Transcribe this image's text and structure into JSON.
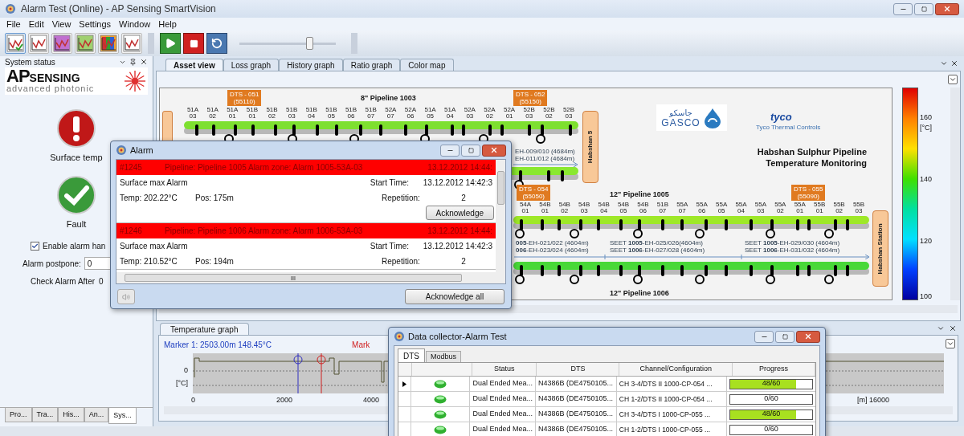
{
  "window": {
    "title": "Alarm Test (Online) - AP Sensing SmartVision"
  },
  "menu": [
    "File",
    "Edit",
    "View",
    "Settings",
    "Window",
    "Help"
  ],
  "toolbar": {
    "slider": {
      "level": 0.74
    }
  },
  "left_panel": {
    "title": "System status",
    "logo": {
      "big": "AP",
      "name": "SENSING",
      "tagline": "advanced photonic"
    },
    "status_items": [
      {
        "kind": "alarm",
        "label": "Surface temp"
      },
      {
        "kind": "ok",
        "label": "Fault"
      }
    ],
    "enable_alarm": {
      "label": "Enable alarm han",
      "checked": true
    },
    "postpone": {
      "label": "Alarm postpone:",
      "value": "0"
    },
    "check_after": {
      "label": "Check Alarm After",
      "value": "0"
    },
    "tabs": [
      {
        "label": "Pro...",
        "selected": false
      },
      {
        "label": "Tra...",
        "selected": false
      },
      {
        "label": "His...",
        "selected": false
      },
      {
        "label": "An...",
        "selected": false
      },
      {
        "label": "Sys...",
        "selected": true
      }
    ]
  },
  "main_tabs": [
    {
      "label": "Asset view",
      "selected": true
    },
    {
      "label": "Loss graph",
      "selected": false
    },
    {
      "label": "History graph",
      "selected": false
    },
    {
      "label": "Ratio graph",
      "selected": false
    },
    {
      "label": "Color map",
      "selected": false
    }
  ],
  "asset_view": {
    "title_lines": [
      "Habshan Sulphur Pipeline",
      "Temperature Monitoring"
    ],
    "gasco": {
      "arabic": "جاسكو",
      "latin": "GASCO"
    },
    "tyco": {
      "name": "tyco",
      "sub": "Tyco Thermal Controls"
    },
    "pipeline_titles": [
      "8\" Pipeline 1003",
      "12\" Pipeline 1005",
      "12\" Pipeline 1006"
    ],
    "dts_boxes": [
      {
        "label": "DTS - 051",
        "sub": "(55110)"
      },
      {
        "label": "DTS - 052",
        "sub": "(55150)"
      },
      {
        "label": "DTS - 054",
        "sub": "(55050)"
      },
      {
        "label": "DTS - 055",
        "sub": "(55090)"
      }
    ],
    "stations": [
      "Habshan 5",
      "Habshan Station"
    ],
    "upper_zones": [
      "51A 03",
      "51A 02",
      "51A 01",
      "51B 01",
      "51B 02",
      "51B 03",
      "51B 04",
      "51B 05",
      "51B 06",
      "51B 07",
      "52A 07",
      "52A 06",
      "51A 05",
      "51A 04",
      "52A 03",
      "52A 02",
      "52A 01",
      "52B 03",
      "52B 02",
      "52B 03"
    ],
    "lower_zones": [
      "54A 01",
      "54B 01",
      "54B 02",
      "54B 03",
      "54B 04",
      "54B 05",
      "54B 06",
      "51B 07",
      "55A 07",
      "55A 06",
      "55A 05",
      "55A 04",
      "55A 03",
      "55A 02",
      "55A 01",
      "55B 01",
      "55B 02",
      "55B 03"
    ],
    "upper_cables": [
      "EH-009/010 (4684m)",
      "EH-011/012 (4684m)"
    ],
    "seet_sections": [
      {
        "top": "**005**-EH-021/022 (4604m)",
        "bottom": "**006**-EH-023/024 (4604m)"
      },
      {
        "top": "SEET **1005**-EH-025/026(4604m)",
        "bottom": "SEET **1006**-EH-027/028 (4604m)"
      },
      {
        "top": "SEET **1005**-EH-029/030 (4604m)",
        "bottom": "SEET **1006**-EH-031/032 (4604m)"
      }
    ]
  },
  "color_scale": {
    "unit": "[°C]",
    "ticks": [
      "160",
      "140",
      "120",
      "100"
    ]
  },
  "temperature_graph": {
    "tab": "Temperature graph",
    "marker_1": "Marker 1: 2503.00m 148.45°C",
    "marker_2": "Mark",
    "y_labels": [
      "0",
      "[°C]"
    ],
    "x_labels": [
      "0",
      "2000",
      "4000",
      "[m] 16000"
    ]
  },
  "alarm_dialog": {
    "title": "Alarm",
    "alarms": [
      {
        "id": "#1245",
        "zone": "Pipeline: Pipeline 1005 Alarm zone: Alarm 1005-53A-03",
        "time": "13.12.2012 14:44:",
        "type": "Surface max Alarm",
        "start_label": "Start Time:",
        "repetition_label": "Repetition:",
        "start": "13.12.2012 14:42:3",
        "temp": "Temp: 202.22°C",
        "pos": "Pos: 175m",
        "repetition": "2",
        "button": "Acknowledge"
      },
      {
        "id": "#1246",
        "zone": "Pipeline: Pipeline 1006 Alarm zone: Alarm 1006-53A-03",
        "time": "13.12.2012 14:44:",
        "type": "Surface max Alarm",
        "start_label": "Start Time:",
        "repetition_label": "Repetition:",
        "start": "13.12.2012 14:42:3",
        "temp": "Temp: 210.52°C",
        "pos": "Pos: 194m",
        "repetition": "2"
      }
    ],
    "scroll_grip": "III",
    "button": "Acknowledge all"
  },
  "data_collector": {
    "title": "Data collector-Alarm Test",
    "tabs": [
      {
        "label": "DTS",
        "selected": true
      },
      {
        "label": "Modbus",
        "selected": false
      }
    ],
    "columns": [
      "Status",
      "DTS",
      "Channel/Configuration",
      "Progress"
    ],
    "rows": [
      {
        "current": true,
        "status": "Dual Ended Mea...",
        "dts": "N4386B (DE4750105...",
        "channel": "CH 3-4/DTS II 1000-CP-054 ...",
        "progress": "48/60",
        "level": 0.8
      },
      {
        "current": false,
        "status": "Dual Ended Mea...",
        "dts": "N4386B (DE4750105...",
        "channel": "CH 1-2/DTS II 1000-CP-054 ...",
        "progress": "0/60",
        "level": 0
      },
      {
        "current": false,
        "status": "Dual Ended Mea...",
        "dts": "N4386B (DE4750105...",
        "channel": "CH 3-4/DTS I 1000-CP-055 ...",
        "progress": "48/60",
        "level": 0.8
      },
      {
        "current": false,
        "status": "Dual Ended Mea...",
        "dts": "N4386B (DE4750105...",
        "channel": "CH 1-2/DTS I 1000-CP-055 ...",
        "progress": "0/60",
        "level": 0
      }
    ]
  }
}
